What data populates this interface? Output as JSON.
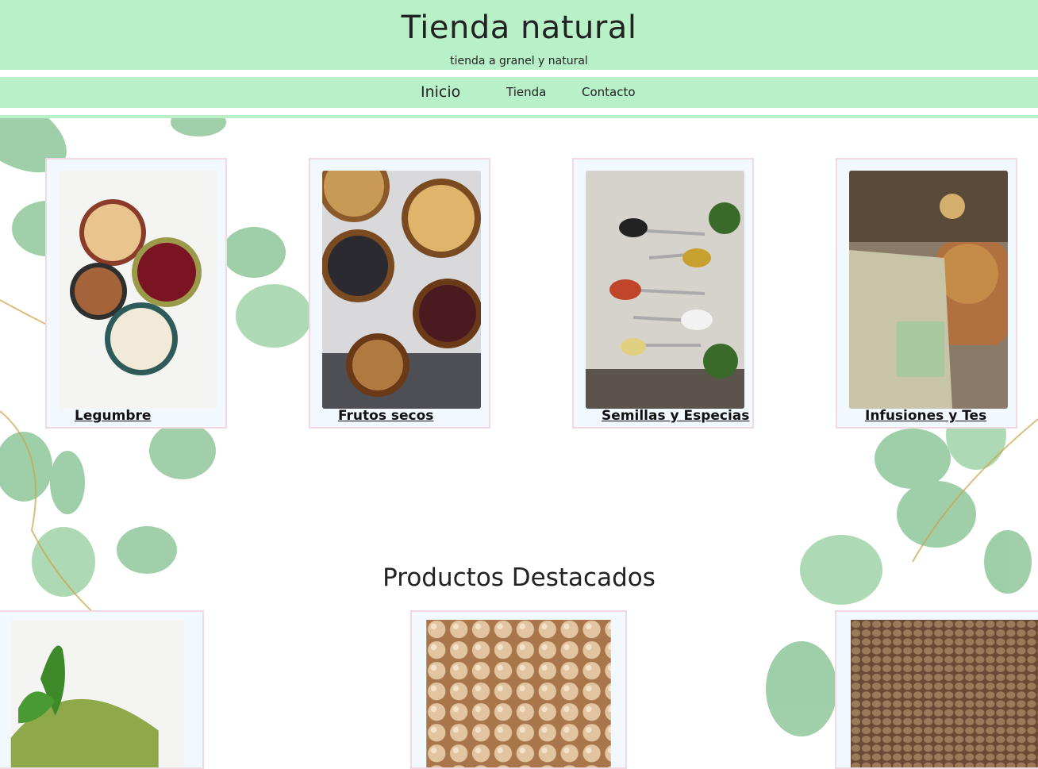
{
  "header": {
    "title": "Tienda natural",
    "subtitle": "tienda a granel y natural"
  },
  "nav": {
    "items": [
      "Inicio",
      "Tienda",
      "Contacto"
    ]
  },
  "categories": [
    {
      "label": "Legumbre",
      "icon": "legumes-photo"
    },
    {
      "label": "Frutos secos",
      "icon": "nuts-photo"
    },
    {
      "label": "Semillas y Especias",
      "icon": "spices-photo"
    },
    {
      "label": "Infusiones y Tes",
      "icon": "tea-photo"
    }
  ],
  "featured": {
    "title": "Productos Destacados",
    "items": [
      {
        "icon": "matcha-powder-photo"
      },
      {
        "icon": "chickpeas-photo"
      },
      {
        "icon": "lentils-photo"
      }
    ]
  },
  "colors": {
    "header_bg": "#b8f0c8",
    "card_bg": "#f2f8ff",
    "card_border": "#f2d8e0"
  }
}
